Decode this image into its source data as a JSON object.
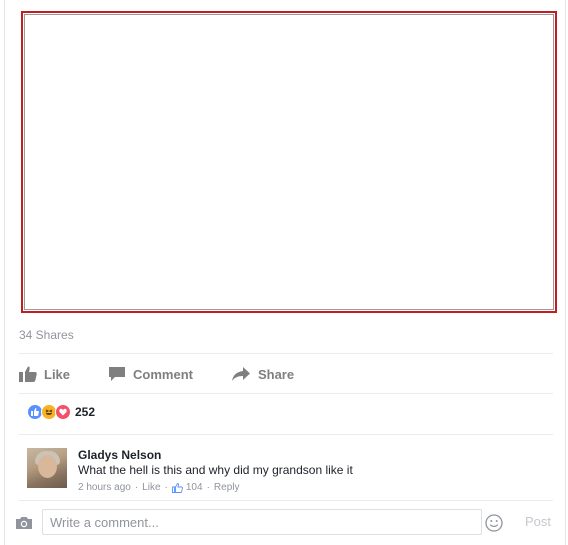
{
  "post": {
    "shares_text": "34 Shares"
  },
  "actions": {
    "like_label": "Like",
    "comment_label": "Comment",
    "share_label": "Share"
  },
  "reactions": {
    "count": "252",
    "types": [
      "like",
      "haha",
      "love"
    ]
  },
  "comment": {
    "author": "Gladys Nelson",
    "text": "What the hell is this and why did my grandson like it",
    "time": "2 hours ago",
    "like_label": "Like",
    "like_count": "104",
    "reply_label": "Reply"
  },
  "composer": {
    "placeholder": "Write a comment...",
    "post_label": "Post"
  },
  "colors": {
    "frame_border": "#c01e22",
    "accent_like": "#5890ff",
    "muted_text": "#90949c"
  }
}
